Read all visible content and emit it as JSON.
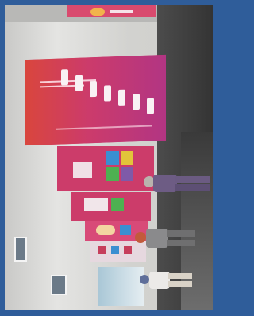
{
  "scene": {
    "description_colors": {
      "border": "#2f5d9a",
      "poster_primary": "#cc3c6a",
      "poster_secondary": "#d9463d",
      "floor": "#3a3a3a"
    }
  }
}
